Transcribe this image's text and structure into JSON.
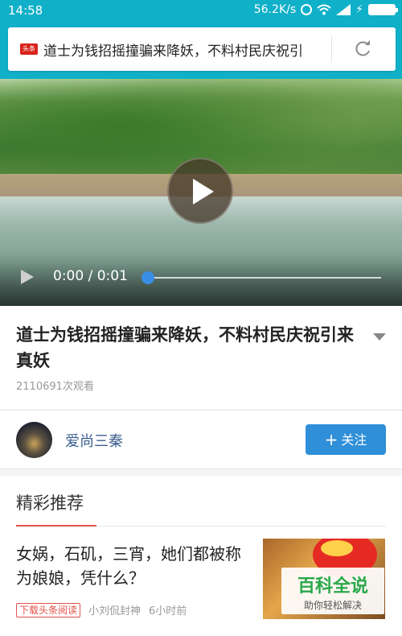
{
  "status_bar": {
    "time": "14:58",
    "network_speed": "56.2K/s",
    "icons": [
      "alarm-icon",
      "wifi-icon",
      "signal-icon",
      "charging-icon",
      "battery-icon"
    ]
  },
  "header": {
    "source_logo_text": "头条",
    "url_title": "道士为钱招摇撞骗来降妖，不料村民庆祝引",
    "accent_color": "#0fb0c8"
  },
  "video": {
    "time_display": "0:00 / 0:01",
    "progress_fraction": 0
  },
  "article": {
    "title": "道士为钱招摇撞骗来降妖，不料村民庆祝引来真妖",
    "views": "2110691次观看"
  },
  "author": {
    "name": "爱尚三秦",
    "follow_label": "关注",
    "follow_color": "#2f8fd8"
  },
  "recommendations": {
    "heading": "精彩推荐",
    "items": [
      {
        "title": "女娲，石矶，三宵，她们都被称为娘娘，凭什么？",
        "tag": "下载头条阅读",
        "source": "小刘侃封神",
        "time": "6小时前"
      }
    ]
  },
  "watermark": {
    "title": "百科全说",
    "subtitle": "助你轻松解决"
  }
}
